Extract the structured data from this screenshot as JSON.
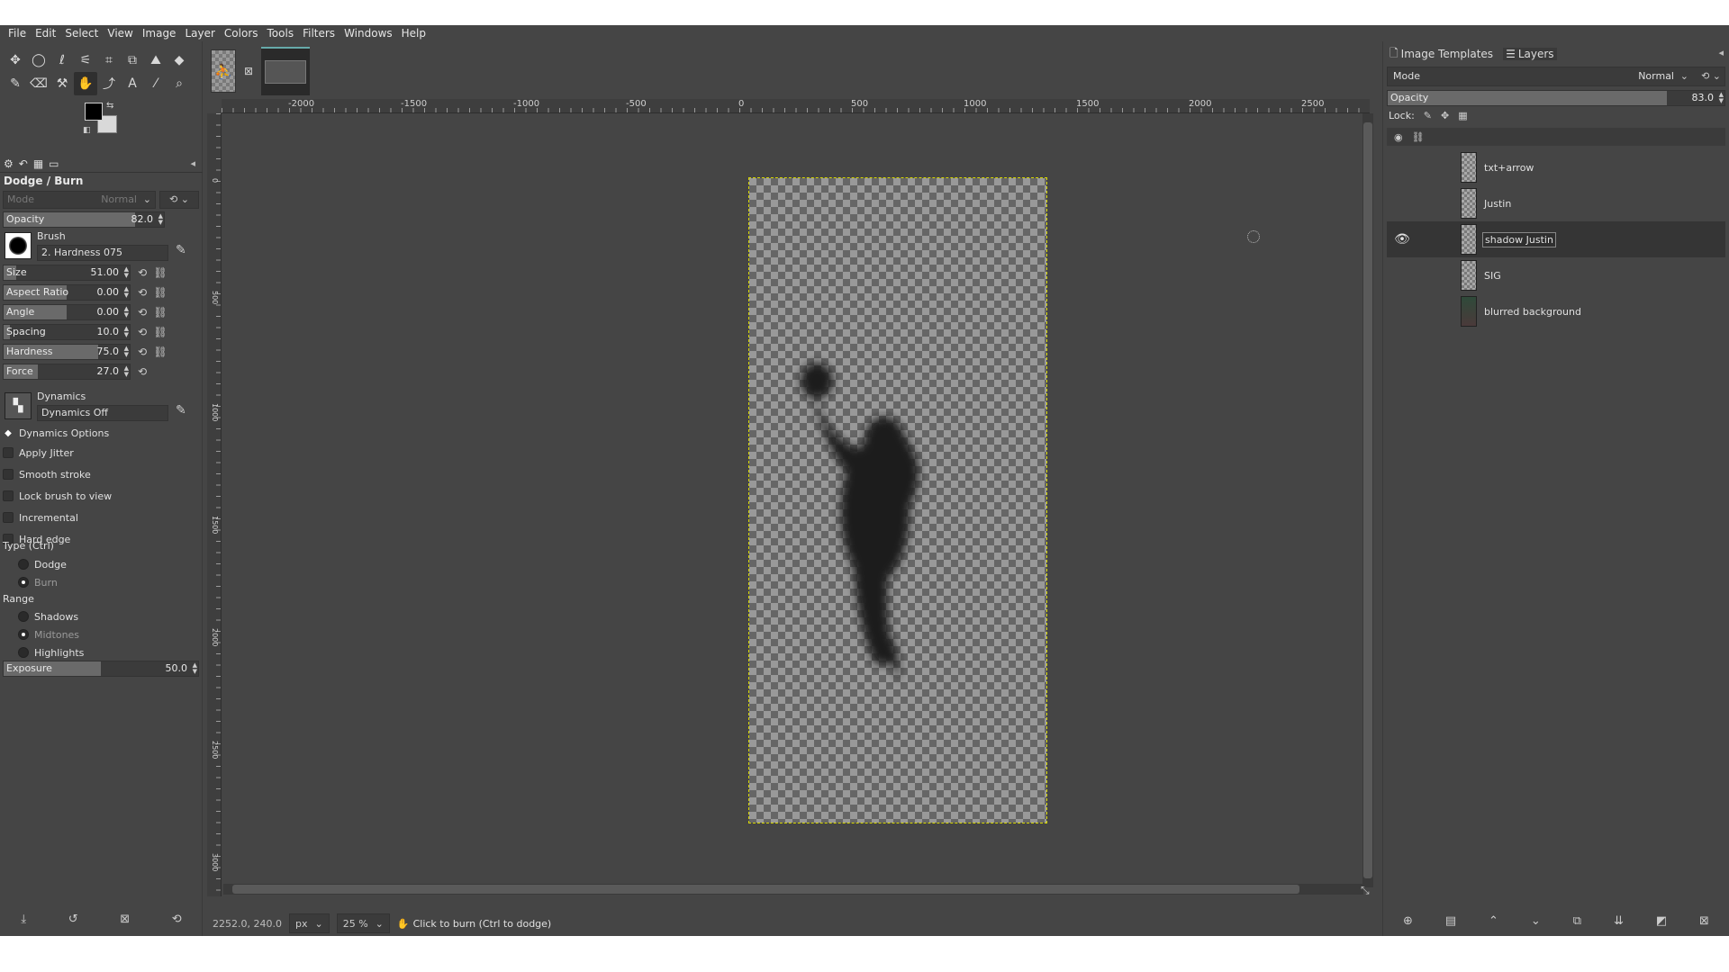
{
  "menu": [
    "File",
    "Edit",
    "Select",
    "View",
    "Image",
    "Layer",
    "Colors",
    "Tools",
    "Filters",
    "Windows",
    "Help"
  ],
  "tools": [
    {
      "icon": "move-icon",
      "glyph": "✥"
    },
    {
      "icon": "ellipse-select-icon",
      "glyph": "◯"
    },
    {
      "icon": "free-select-icon",
      "glyph": "ℓ"
    },
    {
      "icon": "fuzzy-select-icon",
      "glyph": "⚟"
    },
    {
      "icon": "crop-icon",
      "glyph": "⌗"
    },
    {
      "icon": "perspective-icon",
      "glyph": "⧉"
    },
    {
      "icon": "warp-icon",
      "glyph": "⛰"
    },
    {
      "icon": "bucket-fill-icon",
      "glyph": "◆"
    },
    {
      "icon": "paintbrush-icon",
      "glyph": "✎"
    },
    {
      "icon": "eraser-icon",
      "glyph": "⌫"
    },
    {
      "icon": "clone-icon",
      "glyph": "⚒"
    },
    {
      "icon": "dodge-burn-icon",
      "glyph": "✋",
      "active": true
    },
    {
      "icon": "paths-icon",
      "glyph": "⤴"
    },
    {
      "icon": "text-icon",
      "glyph": "A"
    },
    {
      "icon": "color-picker-icon",
      "glyph": "⁄"
    },
    {
      "icon": "zoom-icon",
      "glyph": "⌕"
    }
  ],
  "colors": {
    "foreground": "#000000",
    "background": "#d9d9d9",
    "accent": "#d8d800"
  },
  "tool_options": {
    "title": "Dodge / Burn",
    "mode_label": "Mode",
    "mode_value": "Normal",
    "opacity": {
      "label": "Opacity",
      "value": "82.0",
      "fraction": 0.82
    },
    "brush_label": "Brush",
    "brush_name": "2. Hardness 075",
    "sliders": [
      {
        "label": "Size",
        "value": "51.00",
        "fraction": 0.1
      },
      {
        "label": "Aspect Ratio",
        "value": "0.00",
        "fraction": 0.5
      },
      {
        "label": "Angle",
        "value": "0.00",
        "fraction": 0.5
      },
      {
        "label": "Spacing",
        "value": "10.0",
        "fraction": 0.05
      },
      {
        "label": "Hardness",
        "value": "75.0",
        "fraction": 0.75
      },
      {
        "label": "Force",
        "value": "27.0",
        "fraction": 0.27
      }
    ],
    "dynamics_label": "Dynamics",
    "dynamics_name": "Dynamics Off",
    "dynamics_options": "Dynamics Options",
    "checks": [
      "Apply Jitter",
      "Smooth stroke",
      "Lock brush to view",
      "Incremental",
      "Hard edge"
    ],
    "type_label": "Type  (Ctrl)",
    "type_options": [
      {
        "label": "Dodge",
        "selected": false
      },
      {
        "label": "Burn",
        "selected": true
      }
    ],
    "range_label": "Range",
    "range_options": [
      {
        "label": "Shadows",
        "selected": false
      },
      {
        "label": "Midtones",
        "selected": true
      },
      {
        "label": "Highlights",
        "selected": false
      }
    ],
    "exposure": {
      "label": "Exposure",
      "value": "50.0",
      "fraction": 0.5
    }
  },
  "ruler": {
    "labels": [
      "-2000",
      "-1500",
      "-1000",
      "-500",
      "0",
      "500",
      "1000",
      "1500",
      "2000",
      "2500"
    ]
  },
  "ruler_v": {
    "labels": [
      "0",
      "500",
      "1000",
      "1500",
      "2000",
      "2500",
      "3000"
    ]
  },
  "status": {
    "coords": "2252.0, 240.0",
    "unit": "px",
    "zoom": "25 %",
    "message": "Click to burn (Ctrl to dodge)"
  },
  "right_dock": {
    "tabs": [
      "Image Templates",
      "Layers"
    ],
    "mode_label": "Mode",
    "mode_value": "Normal",
    "opacity": {
      "label": "Opacity",
      "value": "83.0",
      "fraction": 0.83
    },
    "lock_label": "Lock:",
    "layers": [
      {
        "name": "txt+arrow",
        "visible": false,
        "selected": false
      },
      {
        "name": "Justin",
        "visible": false,
        "selected": false
      },
      {
        "name": "shadow Justin",
        "visible": true,
        "selected": true
      },
      {
        "name": "SIG",
        "visible": false,
        "selected": false
      },
      {
        "name": "blurred background",
        "visible": false,
        "selected": false
      }
    ]
  }
}
